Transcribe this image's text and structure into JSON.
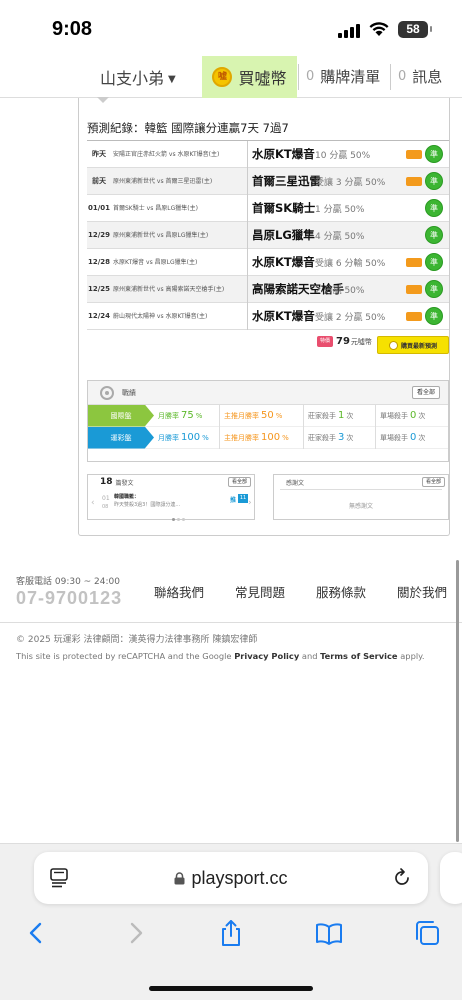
{
  "status_bar": {
    "time": "9:08",
    "battery": "58"
  },
  "nav": {
    "user": "山支小弟",
    "buy_label": "買噓幣",
    "coin_text": "噓",
    "cart_count": "0",
    "cart_label": "購牌清單",
    "msg_count": "0",
    "msg_label": "訊息"
  },
  "record": {
    "title": "預測紀錄：韓籃 國際讓分連贏7天 7過7",
    "rows": [
      {
        "date": "昨天",
        "match": "安陽正官庄赤紅火箭 vs 水原KT爆音(主)",
        "pick": "水原KT爆音",
        "result": "10 分贏 50%",
        "win": "準"
      },
      {
        "date": "前天",
        "match": "原州東浦新世代 vs 首爾三星迅雷(主)",
        "pick": "首爾三星迅雷",
        "result": "受讓 3 分贏 50%",
        "win": "準"
      },
      {
        "date": "01/01",
        "match": "首爾SK騎士 vs 昌原LG獵隼(主)",
        "pick": "首爾SK騎士",
        "result": "1 分贏 50%",
        "win": "準"
      },
      {
        "date": "12/29",
        "match": "原州東浦新世代 vs 昌原LG獵隼(主)",
        "pick": "昌原LG獵隼",
        "result": "4 分贏 50%",
        "win": "準"
      },
      {
        "date": "12/28",
        "match": "水原KT爆音 vs 昌原LG獵隼(主)",
        "pick": "水原KT爆音",
        "result": "受讓 6 分輸 50%",
        "win": "準"
      },
      {
        "date": "12/25",
        "match": "原州東浦新世代 vs 高陽索諾天空槍手(主)",
        "pick": "高陽索諾天空槍手",
        "result": "2 分贏 50%",
        "win": "準"
      },
      {
        "date": "12/24",
        "match": "蔚山現代太陽神 vs 水原KT爆音(主)",
        "pick": "水原KT爆音",
        "result": "受讓 2 分贏 50%",
        "win": "準"
      }
    ],
    "price_tag": "特價",
    "price": "79",
    "price_unit": "元噓幣",
    "buy_latest": "購買最新預測"
  },
  "stats": {
    "title": "戰績",
    "view_all": "看全部",
    "rows": [
      {
        "label": "國際盤",
        "color": "#8cc63f",
        "month_win_label": "月勝率",
        "month_win": "75",
        "host_win_label": "主推月勝率",
        "host_win": "50",
        "killer_label": "莊家殺手",
        "killer": "1",
        "killer_unit": "次",
        "single_label": "單場殺手",
        "single": "0",
        "single_unit": "次"
      },
      {
        "label": "運彩盤",
        "color": "#1a9ad6",
        "month_win_label": "月勝率",
        "month_win": "100",
        "host_win_label": "主推月勝率",
        "host_win": "100",
        "killer_label": "莊家殺手",
        "killer": "3",
        "killer_unit": "次",
        "single_label": "單場殺手",
        "single": "0",
        "single_unit": "次"
      }
    ]
  },
  "posts": {
    "count": "18",
    "title": "篇發文",
    "view_all": "看全部",
    "date_day": "01",
    "date_month": "08",
    "item_title": "韓國職籃：",
    "item_text": "昨天雙殺3過3！國際讓分連...",
    "badge": "推",
    "badge_count": "11"
  },
  "thanks": {
    "title": "感謝文",
    "view_all": "看全部",
    "empty": "無感謝文"
  },
  "footer": {
    "service_label": "客服電話 09:30 ~ 24:00",
    "phone": "07-9700123",
    "links": [
      "聯絡我們",
      "常見問題",
      "服務條款",
      "關於我們"
    ],
    "copyright": "© 2025 玩運彩 法律顧問：漢英得力法律事務所 陳鎮宏律師",
    "captcha_prefix": "This site is protected by reCAPTCHA and the Google",
    "privacy": "Privacy Policy",
    "and": "and",
    "terms": "Terms of Service",
    "apply": "apply."
  },
  "browser": {
    "url": "playsport.cc"
  }
}
